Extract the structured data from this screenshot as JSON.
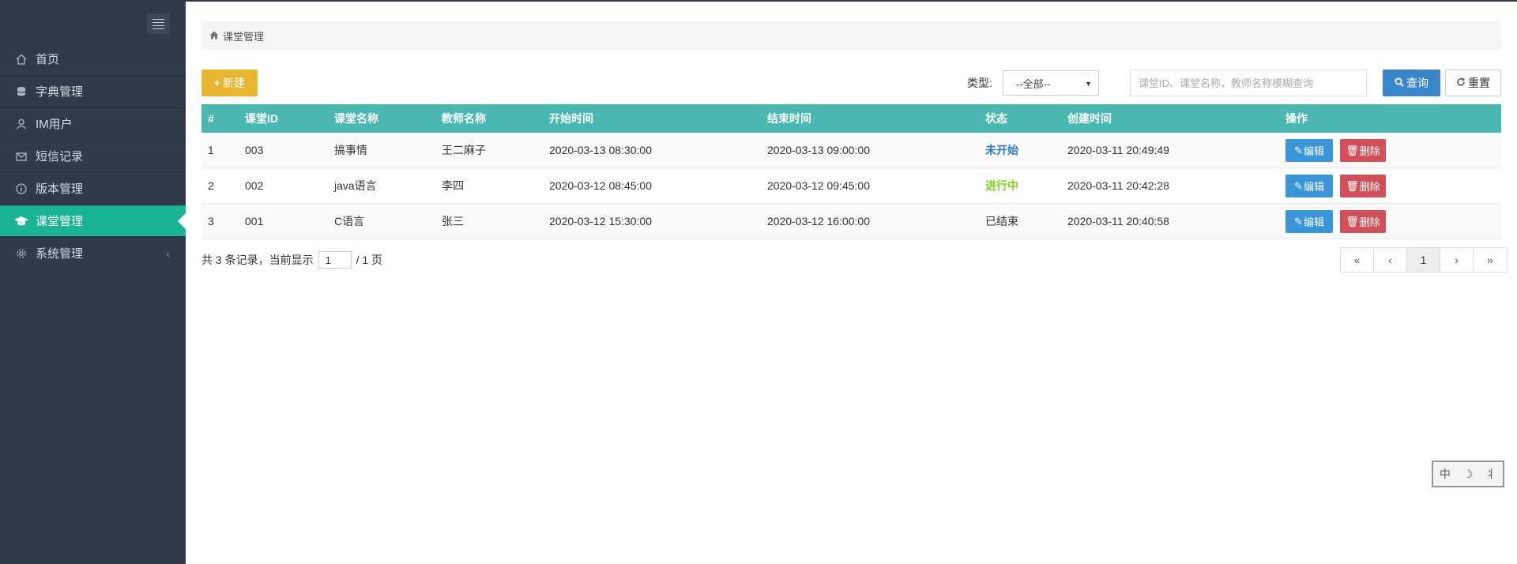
{
  "sidebar": {
    "items": [
      {
        "label": "首页",
        "icon": "home-icon"
      },
      {
        "label": "字典管理",
        "icon": "database-icon"
      },
      {
        "label": "IM用户",
        "icon": "user-icon"
      },
      {
        "label": "短信记录",
        "icon": "envelope-icon"
      },
      {
        "label": "版本管理",
        "icon": "info-icon"
      },
      {
        "label": "课堂管理",
        "icon": "graduation-cap-icon",
        "active": true
      },
      {
        "label": "系统管理",
        "icon": "gear-icon",
        "has_submenu": true
      }
    ],
    "chevron": "‹"
  },
  "breadcrumb": {
    "label": "课堂管理"
  },
  "toolbar": {
    "new_label": "新建",
    "type_label": "类型:",
    "type_selected": "--全部--",
    "search_placeholder": "课堂ID、课堂名称，教师名称模糊查询",
    "query_label": "查询",
    "reset_label": "重置"
  },
  "table": {
    "headers": [
      "#",
      "课堂ID",
      "课堂名称",
      "教师名称",
      "开始时间",
      "结束时间",
      "状态",
      "创建时间",
      "操作"
    ],
    "rows": [
      {
        "no": "1",
        "id": "003",
        "name": "搞事情",
        "teacher": "王二麻子",
        "start": "2020-03-13 08:30:00",
        "end": "2020-03-13 09:00:00",
        "status": "未开始",
        "created": "2020-03-11 20:49:49"
      },
      {
        "no": "2",
        "id": "002",
        "name": "java语言",
        "teacher": "李四",
        "start": "2020-03-12 08:45:00",
        "end": "2020-03-12 09:45:00",
        "status": "进行中",
        "created": "2020-03-11 20:42:28"
      },
      {
        "no": "3",
        "id": "001",
        "name": "C语言",
        "teacher": "张三",
        "start": "2020-03-12 15:30:00",
        "end": "2020-03-12 16:00:00",
        "status": "已结束",
        "created": "2020-03-11 20:40:58"
      }
    ],
    "edit_label": "编辑",
    "delete_label": "删除"
  },
  "footer": {
    "summary_prefix": "共 3 条记录，当前显示",
    "page_value": "1",
    "summary_suffix": "/ 1 页"
  },
  "pagination": {
    "first": "«",
    "prev": "‹",
    "current": "1",
    "next": "›",
    "last": "»"
  },
  "stamp": {
    "chars": [
      "中",
      "☽",
      "⺦"
    ]
  },
  "colors": {
    "sidebar_bg": "#2f3b48",
    "active": "#1ab394",
    "table_header": "#4ab8b0",
    "new_button": "#e8b530",
    "query_button": "#3a86c8",
    "edit_button": "#3a96d8",
    "delete_button": "#d2505a",
    "status_not_started": "#2d7cc1",
    "status_in_progress": "#7ed321"
  }
}
